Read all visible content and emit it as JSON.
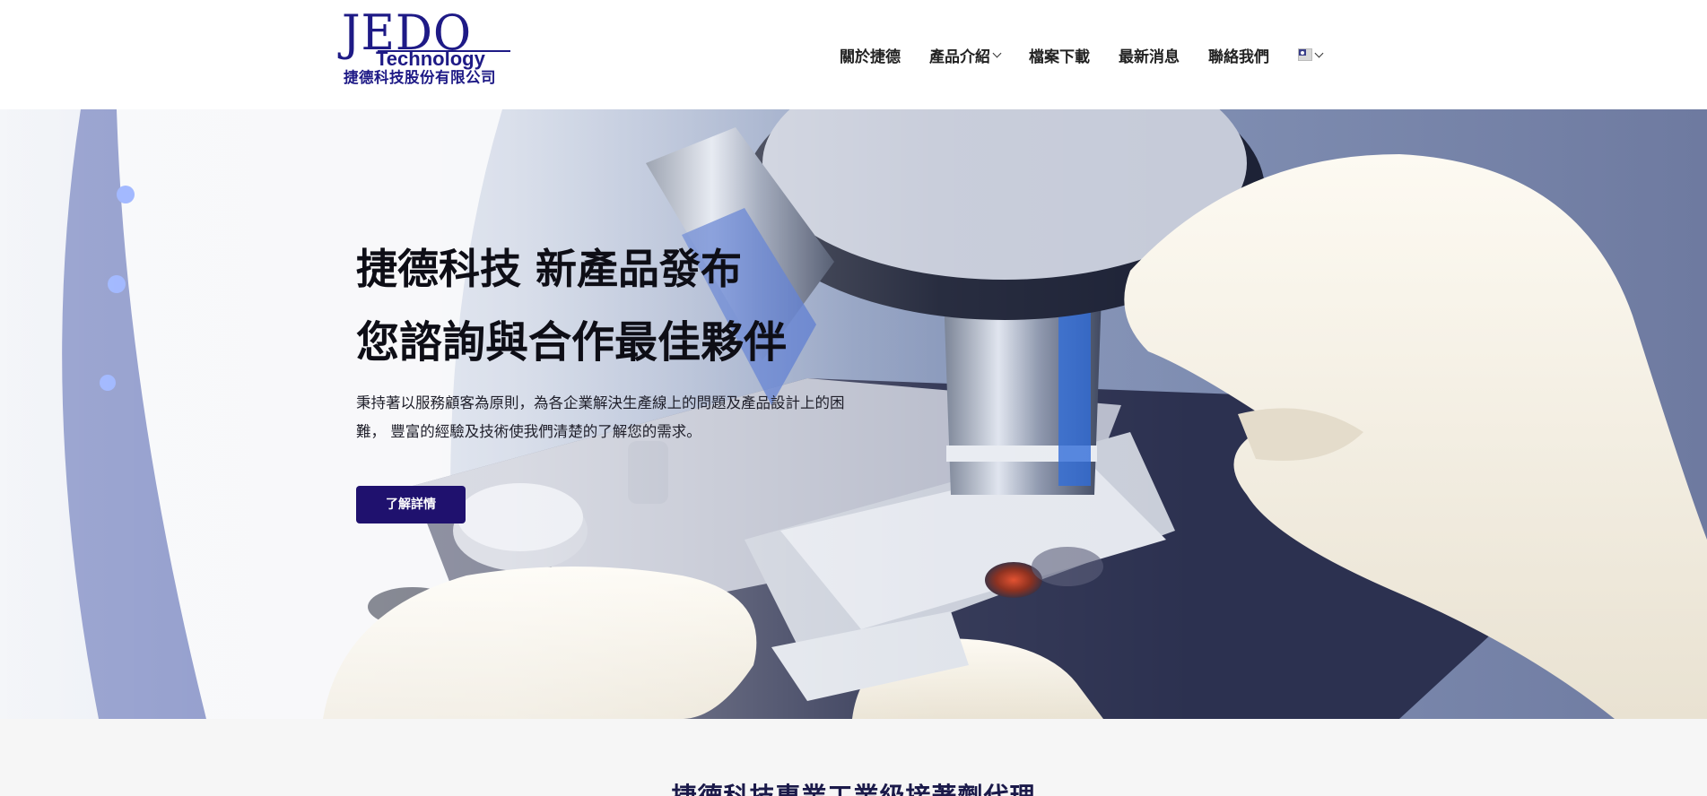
{
  "header": {
    "logo": {
      "mark": "JEDO",
      "sub": "Technology",
      "company": "捷德科技股份有限公司"
    },
    "nav": [
      {
        "label": "關於捷德"
      },
      {
        "label": "產品介紹"
      },
      {
        "label": "檔案下載"
      },
      {
        "label": "最新消息"
      },
      {
        "label": "聯絡我們"
      }
    ],
    "language_icon": "taiwan-flag-icon"
  },
  "hero": {
    "title": "捷德科技 新產品發布",
    "subtitle": "您諮詢與合作最佳夥伴",
    "description_line1": "秉持著以服務顧客為原則，為各企業解決生產線上的問題及產品設計上的困",
    "description_line2": "難， 豐富的經驗及技術使我們清楚的了解您的需求。",
    "cta_label": "了解詳情",
    "image": "microscope-lab-photo"
  },
  "section": {
    "heading": "捷德科技專業工業級接著劑代理"
  },
  "colors": {
    "brand": "#1e1a86",
    "cta_bg": "#1f116e",
    "section_bg": "#f6f6f6"
  }
}
